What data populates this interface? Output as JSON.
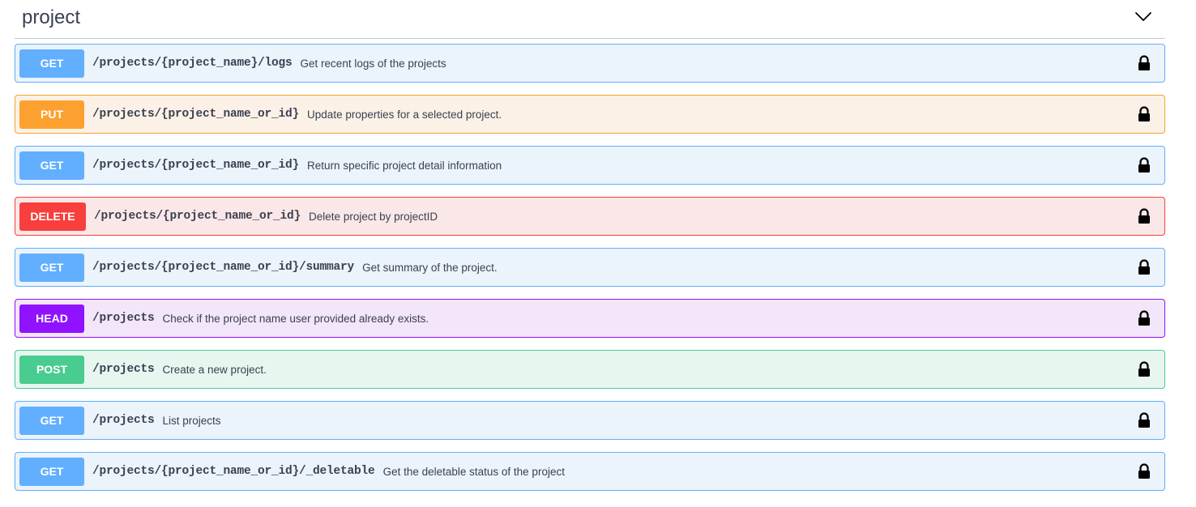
{
  "section": {
    "title": "project",
    "toggle_icon": "chevron-down-icon"
  },
  "operations": [
    {
      "method": "GET",
      "path": "/projects/{project_name}/logs",
      "summary": "Get recent logs of the projects",
      "color": "#61affe",
      "icon": "lock-icon"
    },
    {
      "method": "PUT",
      "path": "/projects/{project_name_or_id}",
      "summary": "Update properties for a selected project.",
      "color": "#fca130",
      "icon": "lock-icon"
    },
    {
      "method": "GET",
      "path": "/projects/{project_name_or_id}",
      "summary": "Return specific project detail information",
      "color": "#61affe",
      "icon": "lock-icon"
    },
    {
      "method": "DELETE",
      "path": "/projects/{project_name_or_id}",
      "summary": "Delete project by projectID",
      "color": "#f93e3e",
      "icon": "lock-icon"
    },
    {
      "method": "GET",
      "path": "/projects/{project_name_or_id}/summary",
      "summary": "Get summary of the project.",
      "color": "#61affe",
      "icon": "lock-icon"
    },
    {
      "method": "HEAD",
      "path": "/projects",
      "summary": "Check if the project name user provided already exists.",
      "color": "#9012fe",
      "icon": "lock-icon"
    },
    {
      "method": "POST",
      "path": "/projects",
      "summary": "Create a new project.",
      "color": "#49cc90",
      "icon": "lock-icon"
    },
    {
      "method": "GET",
      "path": "/projects",
      "summary": "List projects",
      "color": "#61affe",
      "icon": "lock-icon"
    },
    {
      "method": "GET",
      "path": "/projects/{project_name_or_id}/_deletable",
      "summary": "Get the deletable status of the project",
      "color": "#61affe",
      "icon": "lock-icon"
    }
  ]
}
